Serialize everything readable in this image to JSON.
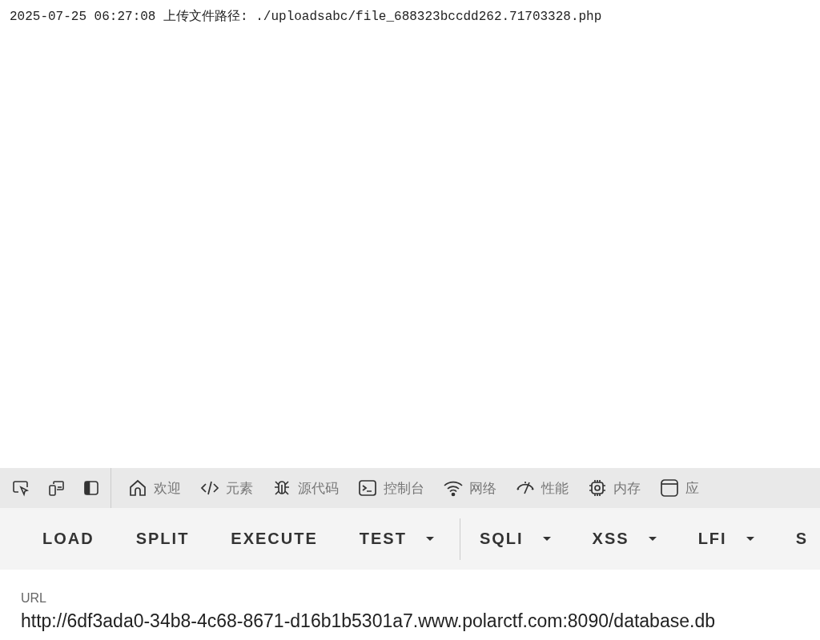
{
  "log_line": "2025-07-25 06:27:08 上传文件路径: ./uploadsabc/file_688323bccdd262.71703328.php",
  "devtools": {
    "tools": [
      {
        "kind": "inspect"
      },
      {
        "kind": "device"
      },
      {
        "kind": "dock"
      }
    ],
    "tabs": [
      {
        "kind": "home",
        "label": "欢迎"
      },
      {
        "kind": "code",
        "label": "元素"
      },
      {
        "kind": "bug",
        "label": "源代码"
      },
      {
        "kind": "console",
        "label": "控制台"
      },
      {
        "kind": "wifi",
        "label": "网络"
      },
      {
        "kind": "gauge",
        "label": "性能"
      },
      {
        "kind": "chip",
        "label": "内存"
      },
      {
        "kind": "window",
        "label": "应"
      }
    ]
  },
  "toolbar": {
    "groups": [
      [
        {
          "label": "LOAD",
          "menu": false
        },
        {
          "label": "SPLIT",
          "menu": false
        },
        {
          "label": "EXECUTE",
          "menu": false
        },
        {
          "label": "TEST",
          "menu": true
        }
      ],
      [
        {
          "label": "SQLI",
          "menu": true
        },
        {
          "label": "XSS",
          "menu": true
        },
        {
          "label": "LFI",
          "menu": true
        },
        {
          "label": "S",
          "menu": false
        }
      ]
    ]
  },
  "url": {
    "label": "URL",
    "value": "http://6df3ada0-34b8-4c68-8671-d16b1b5301a7.www.polarctf.com:8090/database.db"
  }
}
